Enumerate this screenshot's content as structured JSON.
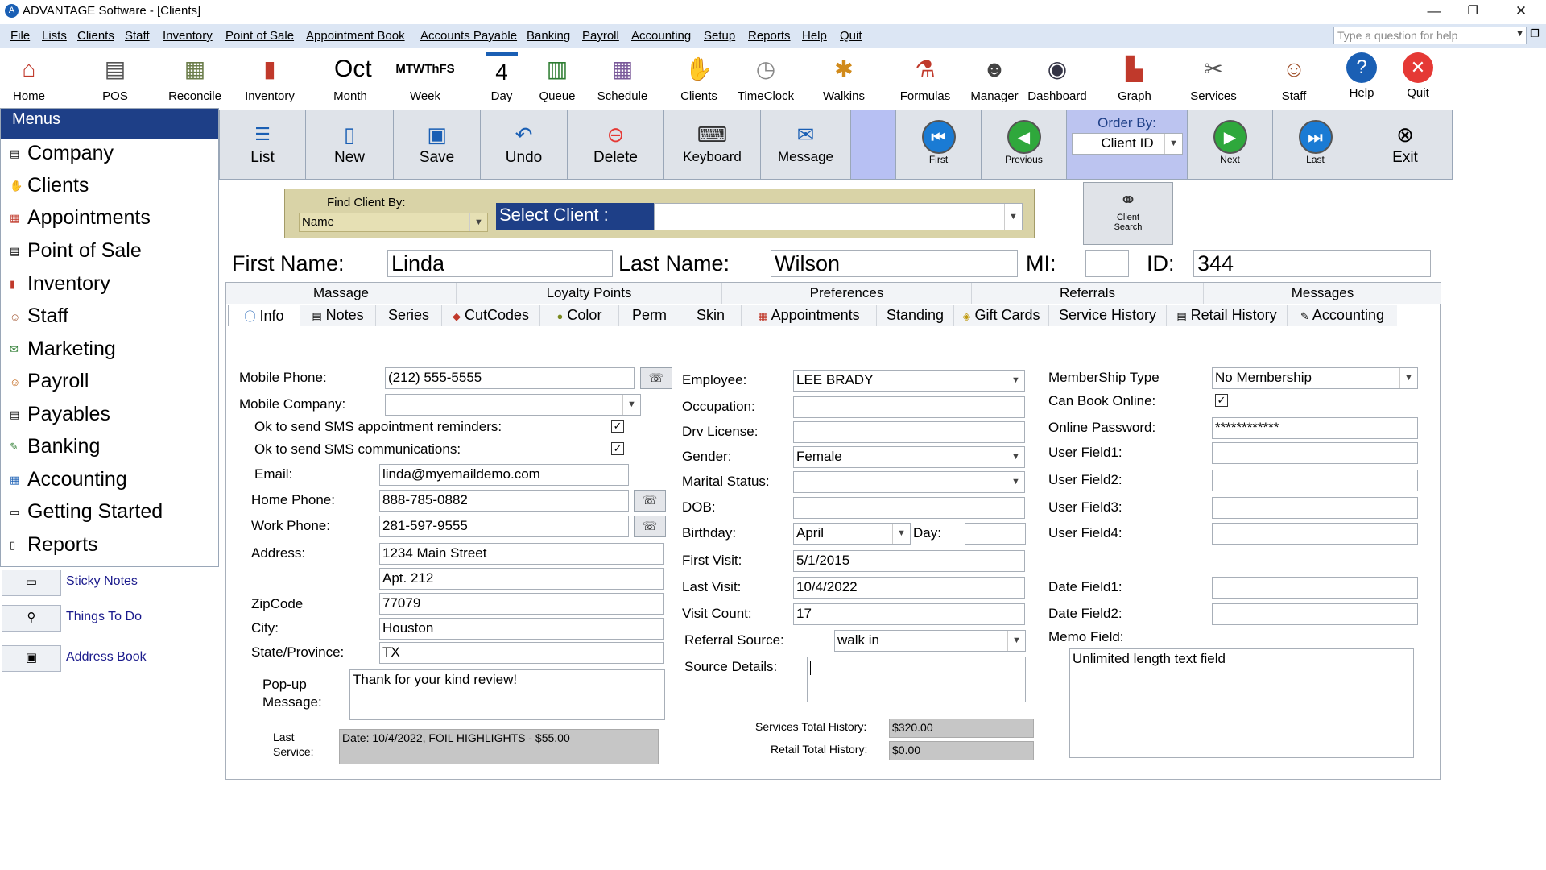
{
  "window": {
    "title": "ADVANTAGE Software - [Clients]",
    "logo": "A"
  },
  "menubar": {
    "items": [
      "File",
      "Lists",
      "Clients",
      "Staff",
      "Inventory",
      "Point of Sale",
      "Appointment Book",
      "Accounts Payable",
      "Banking",
      "Payroll",
      "Accounting",
      "Setup",
      "Reports",
      "Help",
      "Quit"
    ],
    "help_placeholder": "Type a question for help"
  },
  "toolbar": {
    "items": [
      {
        "label": "Home",
        "icon": "house-icon"
      },
      {
        "label": "POS",
        "icon": "cash-register-icon"
      },
      {
        "label": "Reconcile",
        "icon": "money-icon"
      },
      {
        "label": "Inventory",
        "icon": "product-icon"
      },
      {
        "label": "Month",
        "icon": "calendar-month-icon",
        "top": "Oct"
      },
      {
        "label": "Week",
        "icon": "calendar-week-icon",
        "top": "MTWThFS"
      },
      {
        "label": "Day",
        "icon": "calendar-day-icon",
        "top": "4"
      },
      {
        "label": "Queue",
        "icon": "queue-icon"
      },
      {
        "label": "Schedule",
        "icon": "schedule-icon"
      },
      {
        "label": "Clients",
        "icon": "handshake-icon"
      },
      {
        "label": "TimeClock",
        "icon": "clock-icon"
      },
      {
        "label": "Walkins",
        "icon": "walkin-icon"
      },
      {
        "label": "Formulas",
        "icon": "formula-icon"
      },
      {
        "label": "Manager",
        "icon": "manager-icon"
      },
      {
        "label": "Dashboard",
        "icon": "dashboard-icon"
      },
      {
        "label": "Graph",
        "icon": "graph-icon"
      },
      {
        "label": "Services",
        "icon": "scissors-icon"
      },
      {
        "label": "Staff",
        "icon": "staff-icon"
      },
      {
        "label": "Help",
        "icon": "help-icon"
      },
      {
        "label": "Quit",
        "icon": "quit-icon"
      }
    ]
  },
  "left_menu": {
    "title": "Menus",
    "items": [
      "Company",
      "Clients",
      "Appointments",
      "Point of Sale",
      "Inventory",
      "Staff",
      "Marketing",
      "Payroll",
      "Payables",
      "Banking",
      "Accounting",
      "Getting Started",
      "Reports"
    ],
    "shortcuts": [
      "Sticky Notes",
      "Things To Do",
      "Address Book"
    ]
  },
  "subbar": {
    "list": "List",
    "new": "New",
    "save": "Save",
    "undo": "Undo",
    "delete": "Delete",
    "keyboard": "Keyboard",
    "message": "Message",
    "first": "First",
    "previous": "Previous",
    "order_by_label": "Order By:",
    "order_by_value": "Client ID",
    "next": "Next",
    "last": "Last",
    "exit": "Exit"
  },
  "find": {
    "label": "Find Client By:",
    "by_value": "Name",
    "select_label": "Select Client :",
    "client_search": "Client\nSearch",
    "client_search_1": "Client",
    "client_search_2": "Search"
  },
  "client": {
    "first_label": "First Name:",
    "first": "Linda",
    "last_label": "Last Name:",
    "last": "Wilson",
    "mi_label": "MI:",
    "mi": "",
    "id_label": "ID:",
    "id": "344"
  },
  "tabs": {
    "headers": [
      "Massage",
      "Loyalty Points",
      "Preferences",
      "Referrals",
      "Messages"
    ],
    "items": [
      "Info",
      "Notes",
      "Series",
      "CutCodes",
      "Color",
      "Perm",
      "Skin",
      "Appointments",
      "Standing",
      "Gift Cards",
      "Service History",
      "Retail History",
      "Accounting"
    ]
  },
  "info": {
    "mobile_phone_label": "Mobile Phone:",
    "mobile_phone": "(212) 555-5555",
    "mobile_company_label": "Mobile Company:",
    "mobile_company": "",
    "sms_reminders_label": "Ok to send SMS appointment reminders:",
    "sms_comm_label": "Ok to send SMS communications:",
    "email_label": "Email:",
    "email": "linda@myemaildemo.com",
    "home_phone_label": "Home Phone:",
    "home_phone": "888-785-0882",
    "work_phone_label": "Work Phone:",
    "work_phone": "281-597-9555",
    "address_label": "Address:",
    "address1": "1234 Main Street",
    "address2": "Apt. 212",
    "zip_label": "ZipCode",
    "zip": "77079",
    "city_label": "City:",
    "city": "Houston",
    "state_label": "State/Province:",
    "state": "TX",
    "popup_label_1": "Pop-up",
    "popup_label_2": "Message:",
    "popup": "Thank for your kind review!",
    "last_service_label_1": "Last",
    "last_service_label_2": "Service:",
    "last_service": "Date: 10/4/2022, FOIL HIGHLIGHTS - $55.00",
    "employee_label": "Employee:",
    "employee": "LEE BRADY",
    "occupation_label": "Occupation:",
    "occupation": "",
    "drv_label": "Drv License:",
    "drv": "",
    "gender_label": "Gender:",
    "gender": "Female",
    "marital_label": "Marital Status:",
    "marital": "",
    "dob_label": "DOB:",
    "dob": "",
    "birthday_label": "Birthday:",
    "birthday": "April",
    "day_label": "Day:",
    "day": "",
    "first_visit_label": "First Visit:",
    "first_visit": "5/1/2015",
    "last_visit_label": "Last Visit:",
    "last_visit": "10/4/2022",
    "visit_count_label": "Visit Count:",
    "visit_count": "17",
    "referral_label": "Referral Source:",
    "referral": "walk in",
    "source_details_label": "Source Details:",
    "source_details": "",
    "services_total_label": "Services Total History:",
    "services_total": "$320.00",
    "retail_total_label": "Retail Total History:",
    "retail_total": "$0.00",
    "membership_label": "MemberShip Type",
    "membership": "No Membership",
    "book_online_label": "Can Book Online:",
    "password_label": "Online Password:",
    "password": "************",
    "uf1_label": "User Field1:",
    "uf2_label": "User Field2:",
    "uf3_label": "User Field3:",
    "uf4_label": "User Field4:",
    "df1_label": "Date Field1:",
    "df2_label": "Date Field2:",
    "memo_label": "Memo Field:",
    "memo": "Unlimited length text field"
  },
  "colors": {
    "menu_head": "#1e3f87",
    "find_bar": "#d9d3a7",
    "order_bg": "#bcc4f0",
    "readonly": "#c6c6c6"
  }
}
